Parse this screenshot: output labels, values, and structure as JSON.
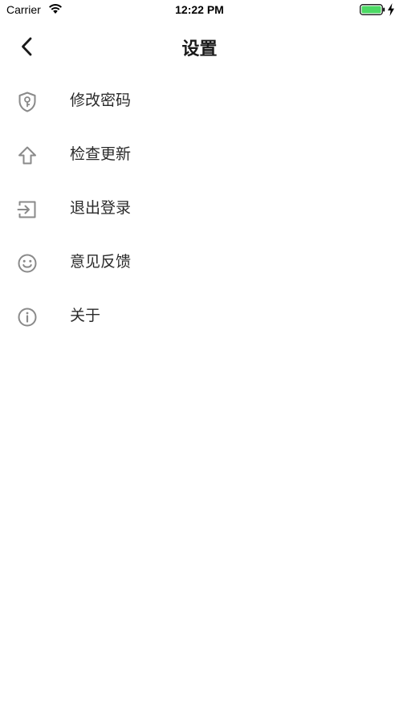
{
  "status_bar": {
    "carrier": "Carrier",
    "time": "12:22 PM",
    "battery_color": "#4cd964"
  },
  "nav": {
    "title": "设置",
    "back_icon": "chevron-left-icon"
  },
  "menu": {
    "items": [
      {
        "label": "修改密码",
        "icon": "shield-key-icon"
      },
      {
        "label": "检查更新",
        "icon": "arrow-up-icon"
      },
      {
        "label": "退出登录",
        "icon": "logout-icon"
      },
      {
        "label": "意见反馈",
        "icon": "smiley-icon"
      },
      {
        "label": "关于",
        "icon": "info-icon"
      }
    ]
  },
  "colors": {
    "icon": "#8a8a8a",
    "text": "#2a2a2a",
    "background": "#ffffff"
  }
}
